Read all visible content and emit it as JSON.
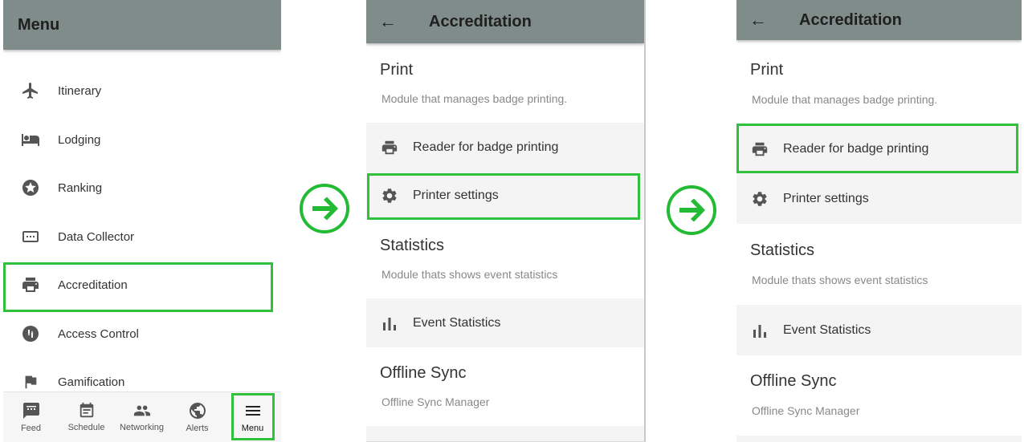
{
  "menu_screen": {
    "title": "Menu",
    "items": [
      {
        "label": "Itinerary",
        "icon": "airplane-icon"
      },
      {
        "label": "Lodging",
        "icon": "hotel-bed-icon"
      },
      {
        "label": "Ranking",
        "icon": "star-circle-icon"
      },
      {
        "label": "Data Collector",
        "icon": "dialpad-icon"
      },
      {
        "label": "Accreditation",
        "icon": "printer-icon"
      },
      {
        "label": "Access Control",
        "icon": "access-control-icon"
      },
      {
        "label": "Gamification",
        "icon": "flag-icon"
      }
    ],
    "bottom_nav": [
      {
        "label": "Feed",
        "icon": "feed-icon"
      },
      {
        "label": "Schedule",
        "icon": "calendar-icon"
      },
      {
        "label": "Networking",
        "icon": "people-icon"
      },
      {
        "label": "Alerts",
        "icon": "globe-icon"
      },
      {
        "label": "Menu",
        "icon": "hamburger-menu-icon"
      }
    ]
  },
  "accreditation_screen": {
    "title": "Accreditation",
    "back_icon": "back-arrow-icon",
    "sections": {
      "print": {
        "title": "Print",
        "subtitle": "Module that manages badge printing.",
        "reader": "Reader for badge printing",
        "printer_settings": "Printer settings"
      },
      "statistics": {
        "title": "Statistics",
        "subtitle": "Module thats shows event statistics",
        "event_statistics": "Event Statistics"
      },
      "offline_sync": {
        "title": "Offline Sync",
        "subtitle": "Offline Sync Manager"
      }
    }
  },
  "flow_arrow_icon": "right-arrow-circle-icon",
  "highlight_color": "#2fc13b",
  "appbar_color": "#7f8c89"
}
